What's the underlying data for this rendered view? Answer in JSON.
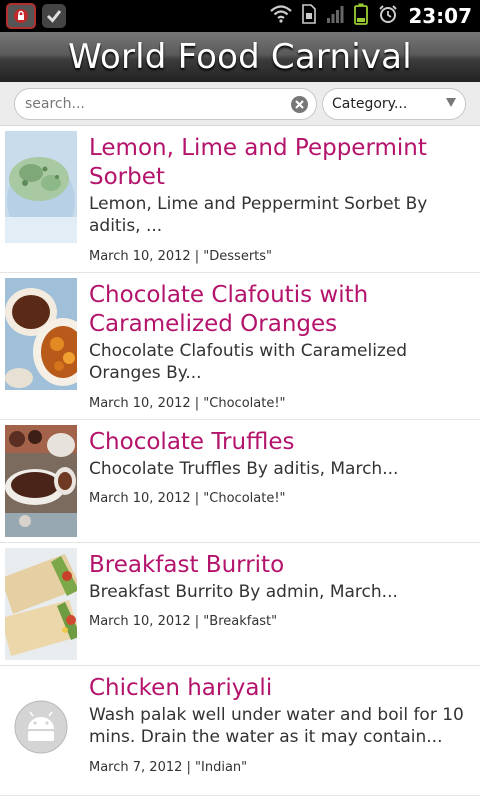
{
  "status_bar": {
    "time": "23:07",
    "icons": [
      "lock-app-icon",
      "checkmark-app-icon",
      "wifi-icon",
      "sim-icon",
      "signal-icon",
      "battery-icon",
      "alarm-icon"
    ]
  },
  "header": {
    "title": "World Food Carnival"
  },
  "search": {
    "placeholder": "search...",
    "value": ""
  },
  "category": {
    "selected": "Category..."
  },
  "colors": {
    "title_accent": "#b4136c",
    "header_bg": "#3c3c3c"
  },
  "items": [
    {
      "title": "Lemon, Lime and Peppermint Sorbet",
      "description": "Lemon, Lime and Peppermint Sorbet By aditis, ...",
      "meta": "March 10, 2012 | \"Desserts\"",
      "thumbnail": "sorbet-image"
    },
    {
      "title": "Chocolate Clafoutis with Caramelized Oranges",
      "description": "Chocolate Clafoutis with Caramelized Oranges By...",
      "meta": "March 10, 2012 | \"Chocolate!\"",
      "thumbnail": "clafoutis-image"
    },
    {
      "title": "Chocolate Truffles",
      "description": "Chocolate Truffles By aditis, March...",
      "meta": "March 10, 2012 | \"Chocolate!\"",
      "thumbnail": "truffles-image"
    },
    {
      "title": "Breakfast Burrito",
      "description": "Breakfast Burrito By admin, March...",
      "meta": "March 10, 2012 | \"Breakfast\"",
      "thumbnail": "burrito-image"
    },
    {
      "title": "Chicken hariyali",
      "description": "Wash palak well under water and boil for 10 mins. Drain the water as it may contain...",
      "meta": "March 7, 2012 | \"Indian\"",
      "thumbnail": "android-placeholder-icon"
    }
  ]
}
